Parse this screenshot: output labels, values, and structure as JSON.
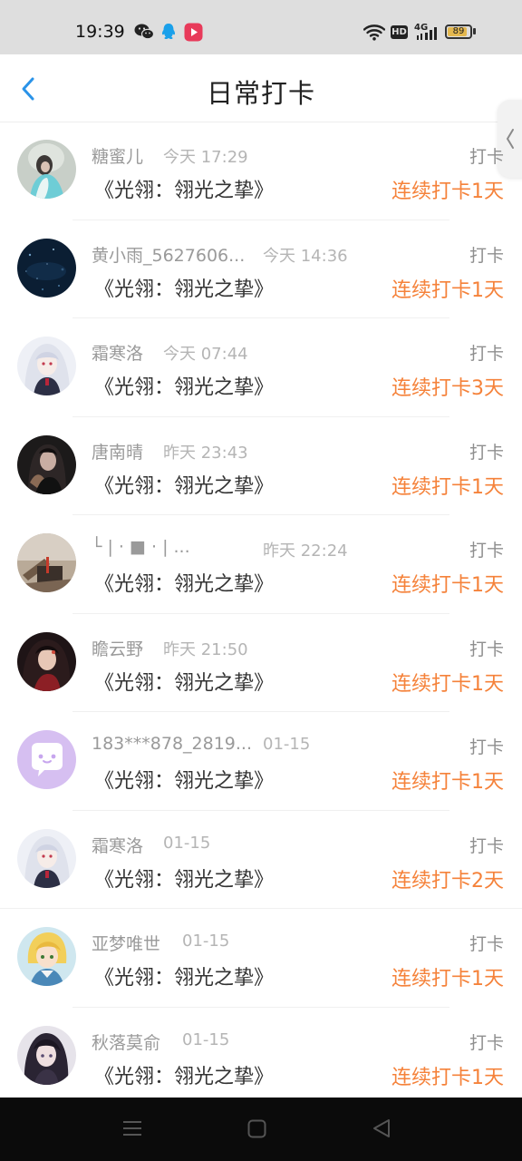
{
  "status_bar": {
    "time": "19:39",
    "network": "4G",
    "hd_label": "HD",
    "battery": "89",
    "battery_level": 0.89
  },
  "header": {
    "title": "日常打卡"
  },
  "list": [
    {
      "name": "糖蜜儿",
      "time": "今天 17:29",
      "action": "打卡",
      "book": "《光翎：翎光之挚》",
      "streak": "连续打卡1天"
    },
    {
      "name": "黄小雨_5627606...",
      "time": "今天 14:36",
      "action": "打卡",
      "book": "《光翎：翎光之挚》",
      "streak": "连续打卡1天"
    },
    {
      "name": "霜寒洛",
      "time": "今天 07:44",
      "action": "打卡",
      "book": "《光翎：翎光之挚》",
      "streak": "连续打卡3天"
    },
    {
      "name": "唐南晴",
      "time": "昨天 23:43",
      "action": "打卡",
      "book": "《光翎：翎光之挚》",
      "streak": "连续打卡1天"
    },
    {
      "name": "└ | · ■ · | ...",
      "time": "昨天 22:24",
      "action": "打卡",
      "book": "《光翎：翎光之挚》",
      "streak": "连续打卡1天"
    },
    {
      "name": "瞻云野",
      "time": "昨天 21:50",
      "action": "打卡",
      "book": "《光翎：翎光之挚》",
      "streak": "连续打卡1天"
    },
    {
      "name": "183***878_2819...",
      "time": "01-15",
      "action": "打卡",
      "book": "《光翎：翎光之挚》",
      "streak": "连续打卡1天"
    },
    {
      "name": "霜寒洛",
      "time": "01-15",
      "action": "打卡",
      "book": "《光翎：翎光之挚》",
      "streak": "连续打卡2天"
    },
    {
      "name": "亚梦唯世",
      "time": "01-15",
      "action": "打卡",
      "book": "《光翎：翎光之挚》",
      "streak": "连续打卡1天"
    },
    {
      "name": "秋落莫俞",
      "time": "01-15",
      "action": "打卡",
      "book": "《光翎：翎光之挚》",
      "streak": "连续打卡1天"
    }
  ],
  "colors": {
    "accent_blue": "#2a93e8",
    "streak_orange": "#f5823a",
    "status_bar_bg": "#dedede"
  },
  "icons": {
    "back": "chevron-left-icon",
    "side_tab": "chevron-left-icon",
    "nav_menu": "menu-icon",
    "nav_home": "home-square-icon",
    "nav_back": "back-triangle-icon"
  }
}
